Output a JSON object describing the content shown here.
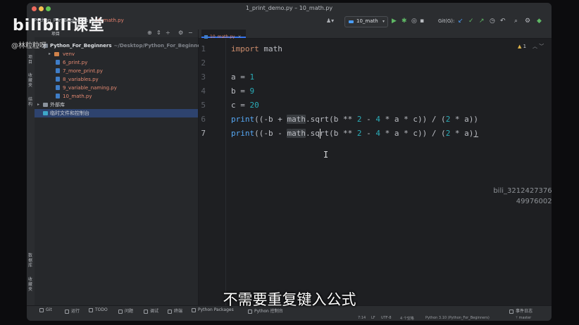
{
  "overlay": {
    "logo": "bilibili课堂",
    "user": "@林粒粒呀"
  },
  "window": {
    "title": "1_print_demo.py – 10_math.py"
  },
  "toolbar": {
    "breadcrumb": [
      "Python_For_Beginners",
      "10_math.py"
    ],
    "run_config": "10_math",
    "git_label": "Git(G):"
  },
  "sidebar": {
    "strip_top": [
      "项目",
      "收藏夹",
      "结构"
    ],
    "strip_bottom": [
      "数据库",
      "收藏夹"
    ]
  },
  "project_panel": {
    "title": "项目",
    "rows": [
      {
        "label": "Python_For_Beginners",
        "path": "~/Desktop/Python_For_Beginners",
        "type": "root"
      },
      {
        "label": "venv",
        "type": "venv"
      },
      {
        "label": "6_print.py",
        "type": "py"
      },
      {
        "label": "7_more_print.py",
        "type": "py"
      },
      {
        "label": "8_variables.py",
        "type": "py"
      },
      {
        "label": "9_variable_naming.py",
        "type": "py"
      },
      {
        "label": "10_math.py",
        "type": "py"
      },
      {
        "label": "外部库",
        "type": "lib"
      },
      {
        "label": "临时文件和控制台",
        "type": "scratch",
        "selected": true
      }
    ]
  },
  "editor": {
    "tab": "10_math.py",
    "line_numbers": [
      "1",
      "2",
      "3",
      "4",
      "5",
      "6",
      "7"
    ],
    "current_line": "7",
    "warnings": "1",
    "lines": {
      "l1": {
        "kw": "import",
        "mod": "math"
      },
      "l3": {
        "var": "a",
        "eq": " = ",
        "val": "1"
      },
      "l4": {
        "var": "b",
        "eq": " = ",
        "val": "9"
      },
      "l5": {
        "var": "c",
        "eq": " = ",
        "val": "20"
      },
      "l6": {
        "fn": "print",
        "p1": "((-b + ",
        "m": "math",
        "p2": ".sqrt(b ** ",
        "n2": "2",
        "p3": " - ",
        "n4": "4",
        "p4": " * a * c)) / (",
        "n2b": "2",
        "p5": " * a))"
      },
      "l7": {
        "fn": "print",
        "p1": "((-b - ",
        "m1": "m",
        "m2": "ath",
        "p2": ".sqrt(b ** ",
        "n2": "2",
        "p3": " - ",
        "n4": "4",
        "p4": " * a * c)) / (",
        "n2b": "2",
        "p5": " * a)",
        "p6": ")"
      }
    },
    "watermark": [
      "bili_32124273760",
      "499760028"
    ]
  },
  "tool_windows": [
    "Git",
    "运行",
    "TODO",
    "问题",
    "调试",
    "终端",
    "Python Packages",
    "Python 控制台",
    "事件日志"
  ],
  "status_bar": {
    "position": "7:14",
    "line_sep": "LF",
    "encoding": "UTF-8",
    "indent": "4 个空格",
    "interpreter": "Python 3.10 (Python_For_Beginners)",
    "branch": "master"
  },
  "subtitle": "不需要重复键入公式",
  "colors": {
    "keyword": "#cf8e6d",
    "function": "#56a8f5",
    "number": "#2aacb8",
    "selection": "#2e436e",
    "accent": "#3574f0"
  }
}
